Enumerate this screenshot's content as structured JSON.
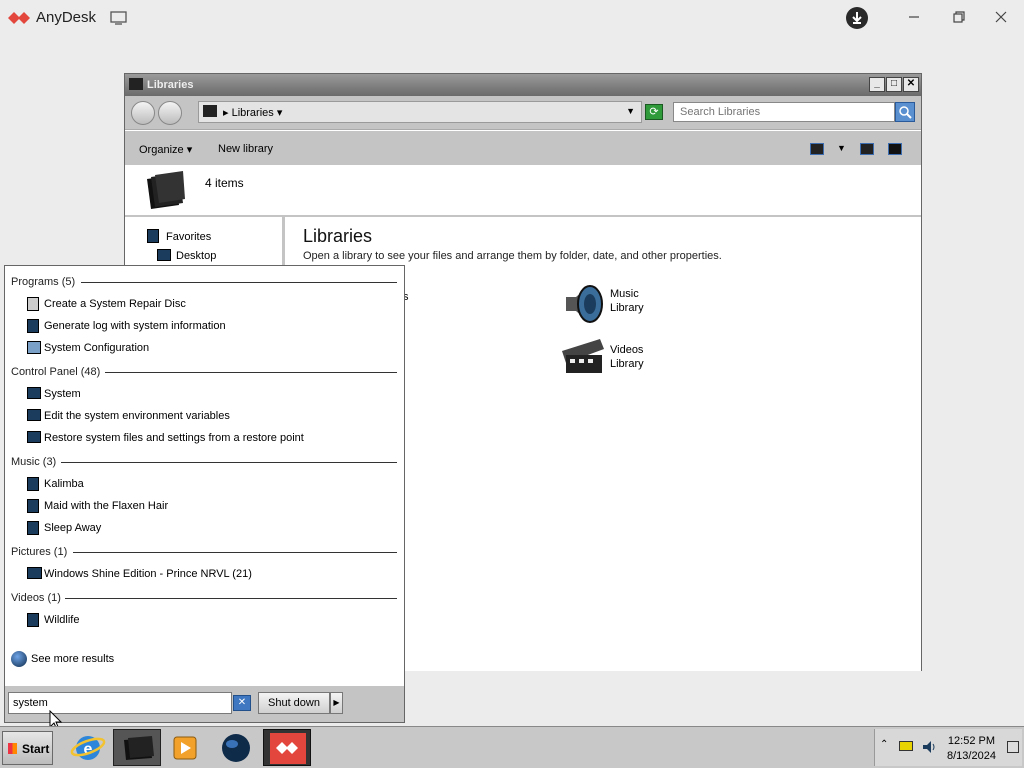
{
  "anydesk": {
    "title": "AnyDesk"
  },
  "explorer": {
    "title": "Libraries",
    "address": "Libraries",
    "search_placeholder": "Search Libraries",
    "toolbar": {
      "organize": "Organize",
      "new_library": "New library"
    },
    "header": {
      "count": "4 items"
    },
    "nav_pane": {
      "items": [
        {
          "label": "Favorites"
        },
        {
          "label": "Desktop"
        }
      ]
    },
    "content": {
      "title": "Libraries",
      "description": "Open a library to see your files and arrange them by folder, date, and other properties.",
      "partial_tile_text": "s",
      "libraries": [
        {
          "label": "Music\nLibrary",
          "icon": "speaker-icon"
        },
        {
          "label": "Videos\nLibrary",
          "icon": "film-icon"
        }
      ]
    }
  },
  "start_menu": {
    "groups": [
      {
        "header": "Programs (5)",
        "items": [
          "Create a System Repair Disc",
          "Generate log with system information",
          "System Configuration"
        ]
      },
      {
        "header": "Control Panel (48)",
        "items": [
          "System",
          "Edit the system environment variables",
          "Restore system files and settings from a restore point"
        ]
      },
      {
        "header": "Music (3)",
        "items": [
          "Kalimba",
          "Maid with the Flaxen Hair",
          "Sleep Away"
        ]
      },
      {
        "header": "Pictures (1)",
        "items": [
          "Windows Shine Edition - Prince NRVL (21)"
        ]
      },
      {
        "header": "Videos (1)",
        "items": [
          "Wildlife"
        ]
      }
    ],
    "see_more": "See more results",
    "search_value": "system",
    "shutdown_label": "Shut down"
  },
  "taskbar": {
    "start_label": "Start",
    "clock_time": "12:52 PM",
    "clock_date": "8/13/2024",
    "apps": [
      "internet-explorer-icon",
      "libraries-icon",
      "media-player-icon",
      "globe-icon",
      "anydesk-icon"
    ]
  }
}
